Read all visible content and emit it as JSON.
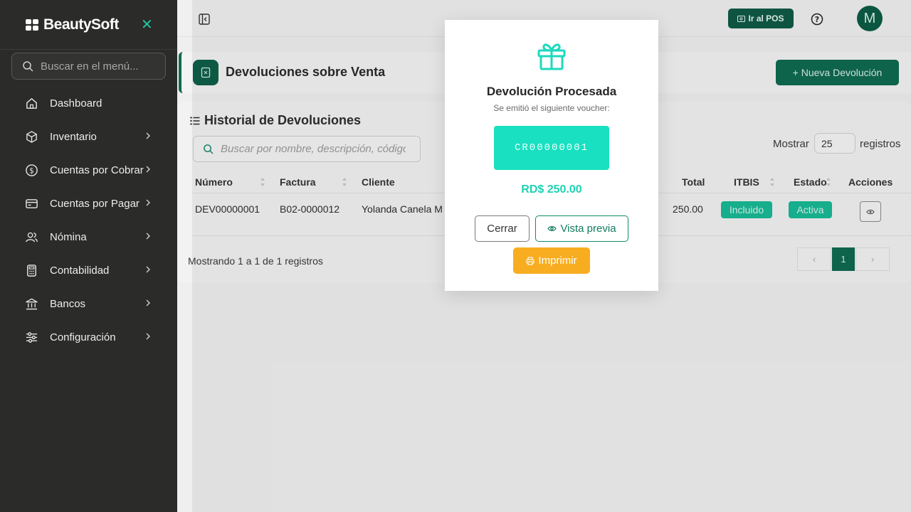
{
  "sidebar": {
    "brand": "BeautySoft",
    "search_placeholder": "Buscar en el menú...",
    "items": [
      {
        "label": "Dashboard"
      },
      {
        "label": "Inventario"
      },
      {
        "label": "Cuentas por Cobrar"
      },
      {
        "label": "Cuentas por Pagar"
      },
      {
        "label": "Nómina"
      },
      {
        "label": "Contabilidad"
      },
      {
        "label": "Bancos"
      },
      {
        "label": "Configuración"
      }
    ]
  },
  "topbar": {
    "pos_label": "Ir al POS",
    "avatar_initial": "M"
  },
  "page": {
    "title": "Devoluciones sobre Venta",
    "new_button": "+ Nueva Devolución"
  },
  "card": {
    "title": "Historial de Devoluciones",
    "search_placeholder": "Buscar por nombre, descripción, código...",
    "show_label": "Mostrar",
    "show_value": "25",
    "records_label": "registros",
    "columns": [
      "Número",
      "Factura",
      "Cliente",
      "Total",
      "ITBIS",
      "Estado",
      "Acciones"
    ],
    "rows": [
      {
        "numero": "DEV00000001",
        "factura": "B02-0000012",
        "cliente": "Yolanda Canela M",
        "total": "250.00",
        "itbis": "Incluido",
        "estado": "Activa"
      }
    ],
    "footer": "Mostrando 1 a 1 de 1 registros",
    "pager": {
      "prev": "‹",
      "current": "1",
      "next": "›"
    }
  },
  "modal": {
    "title": "Devolución Procesada",
    "subtitle": "Se emitió el siguiente voucher:",
    "voucher": "CR00000001",
    "amount": "RD$ 250.00",
    "close": "Cerrar",
    "preview": "Vista previa",
    "print": "Imprimir"
  },
  "colors": {
    "sidebar_bg": "#2b2b29",
    "primary": "#0f6a50",
    "accent_teal": "#18e0c0",
    "print_orange": "#f8ad20"
  }
}
